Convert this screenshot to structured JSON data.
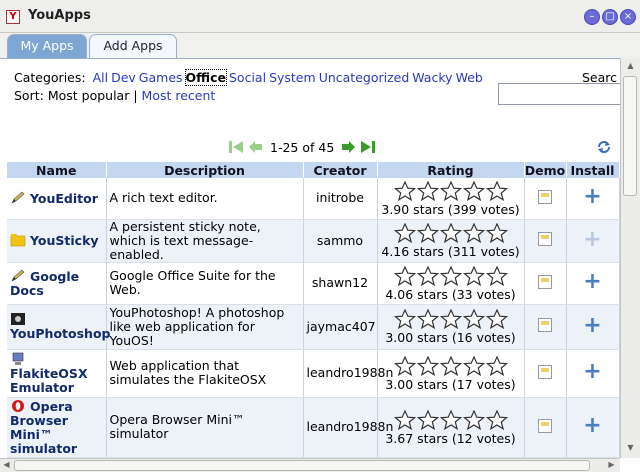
{
  "window": {
    "title": "YouApps"
  },
  "tabs": [
    {
      "label": "My Apps",
      "active": false
    },
    {
      "label": "Add Apps",
      "active": true
    }
  ],
  "categories": {
    "label": "Categories:",
    "items": [
      "All",
      "Dev",
      "Games",
      "Office",
      "Social",
      "System",
      "Uncategorized",
      "Wacky",
      "Web"
    ],
    "selected": "Office"
  },
  "sort": {
    "label": "Sort:",
    "options": [
      "Most popular",
      "Most recent"
    ],
    "separator": "|"
  },
  "search": {
    "label": "Search",
    "label_shown": "Searc",
    "value": ""
  },
  "pager": {
    "range": "1-25 of 45"
  },
  "table": {
    "headers": [
      "Name",
      "Description",
      "Creator",
      "Rating",
      "Demo",
      "Install"
    ],
    "rows": [
      {
        "name": "YouEditor",
        "icon": "pencil-icon",
        "description": "A rich text editor.",
        "creator": "initrobe",
        "rating": 3.9,
        "votes_text": "3.90 stars (399 votes)",
        "install_enabled": true
      },
      {
        "name": "YouSticky",
        "icon": "folder-icon",
        "description": "A persistent sticky note, which is text message-enabled.",
        "creator": "sammo",
        "rating": 4.16,
        "votes_text": "4.16 stars (311 votes)",
        "install_enabled": false
      },
      {
        "name": "Google Docs",
        "icon": "pencil-icon",
        "description": "Google Office Suite for the Web.",
        "creator": "shawn12",
        "rating": 4.06,
        "votes_text": "4.06 stars (33 votes)",
        "install_enabled": true
      },
      {
        "name": "YouPhotoshop",
        "icon": "photoshop-icon",
        "description": "YouPhotoshop! A photoshop like web application for YouOS!",
        "creator": "jaymac407",
        "rating": 3.0,
        "votes_text": "3.00 stars (16 votes)",
        "install_enabled": true
      },
      {
        "name": "FlakiteOSX Emulator",
        "icon": "computer-icon",
        "description": "Web application that simulates the FlakiteOSX",
        "creator": "leandro1988n",
        "rating": 3.0,
        "votes_text": "3.00 stars (17 votes)",
        "install_enabled": true
      },
      {
        "name": "Opera Browser Mini™ simulator",
        "icon": "opera-icon",
        "description": "Opera Browser Mini™ simulator",
        "creator": "leandro1988n",
        "rating": 3.67,
        "votes_text": "3.67 stars (12 votes)",
        "install_enabled": true
      }
    ]
  },
  "colors": {
    "header": "#c4d7f0",
    "link": "#2b3bc0",
    "tab_active": "#7ea6d4",
    "name_text": "#102a6a",
    "install_plus": "#4a7ec0"
  }
}
